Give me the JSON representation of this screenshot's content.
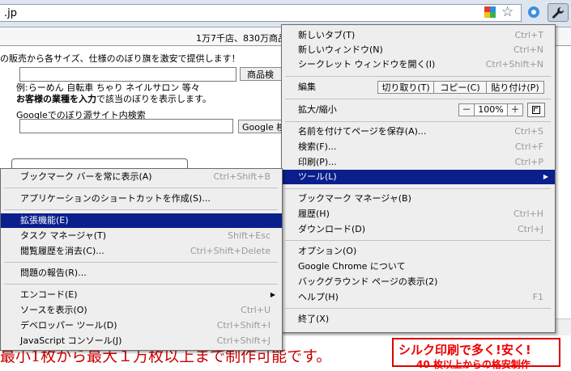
{
  "toolbar": {
    "url": ".jp",
    "icons": [
      "page-action-icon",
      "star-icon",
      "extension-icon",
      "wrench-icon"
    ]
  },
  "page": {
    "stats": "1万7千店、830万商品",
    "description": "の販売から各サイズ、仕様ののぼり旗を激安で提供します！",
    "search_button": "商品検",
    "example": "例:らーめん 自転車 ちゃり ネイルサロン 等々",
    "bold_line_a": "お客様の業種を入力",
    "bold_line_b": "で該当のぼりを表示します。",
    "google_label": "Googleでのぼり源サイト内検索",
    "google_button": "Google 検",
    "red_text": "最小1枚から最大１万枚以上まで制作可能です。",
    "banner_line1": "シルク印刷で多く!安く!",
    "banner_line2": "40 枚以上からの格安制作"
  },
  "main_menu": {
    "new_tab": "新しいタブ(T)",
    "new_tab_sc": "Ctrl+T",
    "new_window": "新しいウィンドウ(N)",
    "new_window_sc": "Ctrl+N",
    "incognito": "シークレット ウィンドウを開く(I)",
    "incognito_sc": "Ctrl+Shift+N",
    "edit": "編集",
    "cut": "切り取り(T)",
    "copy": "コピー(C)",
    "paste": "貼り付け(P)",
    "zoom": "拡大/縮小",
    "zoom_minus": "－",
    "zoom_value": "100%",
    "zoom_plus": "＋",
    "save_as": "名前を付けてページを保存(A)...",
    "save_as_sc": "Ctrl+S",
    "find": "検索(F)...",
    "find_sc": "Ctrl+F",
    "print": "印刷(P)...",
    "print_sc": "Ctrl+P",
    "tools": "ツール(L)",
    "bookmark_manager": "ブックマーク マネージャ(B)",
    "history": "履歴(H)",
    "history_sc": "Ctrl+H",
    "downloads": "ダウンロード(D)",
    "downloads_sc": "Ctrl+J",
    "options": "オプション(O)",
    "about": "Google Chrome について",
    "background": "バックグラウンド ページの表示(2)",
    "help": "ヘルプ(H)",
    "help_sc": "F1",
    "exit": "終了(X)"
  },
  "tools_menu": {
    "always_show_bookmarks": "ブックマーク バーを常に表示(A)",
    "always_show_bookmarks_sc": "Ctrl+Shift+B",
    "create_shortcuts": "アプリケーションのショートカットを作成(S)...",
    "extensions": "拡張機能(E)",
    "task_manager": "タスク マネージャ(T)",
    "task_manager_sc": "Shift+Esc",
    "clear_history": "閲覧履歴を消去(C)...",
    "clear_history_sc": "Ctrl+Shift+Delete",
    "report_issue": "問題の報告(R)...",
    "encoding": "エンコード(E)",
    "view_source": "ソースを表示(O)",
    "view_source_sc": "Ctrl+U",
    "developer_tools": "デベロッパー ツール(D)",
    "developer_tools_sc": "Ctrl+Shift+I",
    "js_console": "JavaScript コンソール(J)",
    "js_console_sc": "Ctrl+Shift+J"
  },
  "colors": {
    "highlight": "#0a1f8c",
    "menu_bg": "#eeeeee",
    "accent_red": "#e00000"
  }
}
